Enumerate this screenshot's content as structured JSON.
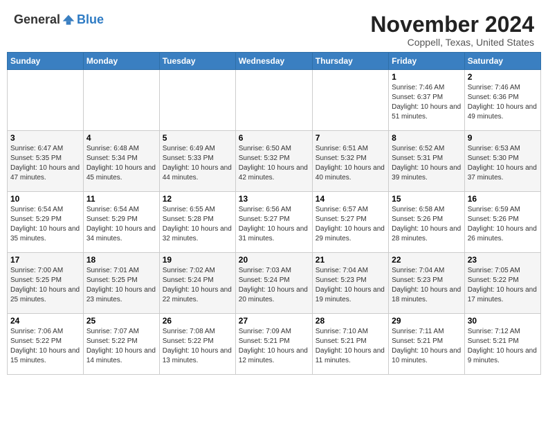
{
  "header": {
    "logo_general": "General",
    "logo_blue": "Blue",
    "month_title": "November 2024",
    "location": "Coppell, Texas, United States"
  },
  "days_of_week": [
    "Sunday",
    "Monday",
    "Tuesday",
    "Wednesday",
    "Thursday",
    "Friday",
    "Saturday"
  ],
  "weeks": [
    [
      {
        "day": "",
        "info": ""
      },
      {
        "day": "",
        "info": ""
      },
      {
        "day": "",
        "info": ""
      },
      {
        "day": "",
        "info": ""
      },
      {
        "day": "",
        "info": ""
      },
      {
        "day": "1",
        "info": "Sunrise: 7:46 AM\nSunset: 6:37 PM\nDaylight: 10 hours\nand 51 minutes."
      },
      {
        "day": "2",
        "info": "Sunrise: 7:46 AM\nSunset: 6:36 PM\nDaylight: 10 hours\nand 49 minutes."
      }
    ],
    [
      {
        "day": "3",
        "info": "Sunrise: 6:47 AM\nSunset: 5:35 PM\nDaylight: 10 hours\nand 47 minutes."
      },
      {
        "day": "4",
        "info": "Sunrise: 6:48 AM\nSunset: 5:34 PM\nDaylight: 10 hours\nand 45 minutes."
      },
      {
        "day": "5",
        "info": "Sunrise: 6:49 AM\nSunset: 5:33 PM\nDaylight: 10 hours\nand 44 minutes."
      },
      {
        "day": "6",
        "info": "Sunrise: 6:50 AM\nSunset: 5:32 PM\nDaylight: 10 hours\nand 42 minutes."
      },
      {
        "day": "7",
        "info": "Sunrise: 6:51 AM\nSunset: 5:32 PM\nDaylight: 10 hours\nand 40 minutes."
      },
      {
        "day": "8",
        "info": "Sunrise: 6:52 AM\nSunset: 5:31 PM\nDaylight: 10 hours\nand 39 minutes."
      },
      {
        "day": "9",
        "info": "Sunrise: 6:53 AM\nSunset: 5:30 PM\nDaylight: 10 hours\nand 37 minutes."
      }
    ],
    [
      {
        "day": "10",
        "info": "Sunrise: 6:54 AM\nSunset: 5:29 PM\nDaylight: 10 hours\nand 35 minutes."
      },
      {
        "day": "11",
        "info": "Sunrise: 6:54 AM\nSunset: 5:29 PM\nDaylight: 10 hours\nand 34 minutes."
      },
      {
        "day": "12",
        "info": "Sunrise: 6:55 AM\nSunset: 5:28 PM\nDaylight: 10 hours\nand 32 minutes."
      },
      {
        "day": "13",
        "info": "Sunrise: 6:56 AM\nSunset: 5:27 PM\nDaylight: 10 hours\nand 31 minutes."
      },
      {
        "day": "14",
        "info": "Sunrise: 6:57 AM\nSunset: 5:27 PM\nDaylight: 10 hours\nand 29 minutes."
      },
      {
        "day": "15",
        "info": "Sunrise: 6:58 AM\nSunset: 5:26 PM\nDaylight: 10 hours\nand 28 minutes."
      },
      {
        "day": "16",
        "info": "Sunrise: 6:59 AM\nSunset: 5:26 PM\nDaylight: 10 hours\nand 26 minutes."
      }
    ],
    [
      {
        "day": "17",
        "info": "Sunrise: 7:00 AM\nSunset: 5:25 PM\nDaylight: 10 hours\nand 25 minutes."
      },
      {
        "day": "18",
        "info": "Sunrise: 7:01 AM\nSunset: 5:25 PM\nDaylight: 10 hours\nand 23 minutes."
      },
      {
        "day": "19",
        "info": "Sunrise: 7:02 AM\nSunset: 5:24 PM\nDaylight: 10 hours\nand 22 minutes."
      },
      {
        "day": "20",
        "info": "Sunrise: 7:03 AM\nSunset: 5:24 PM\nDaylight: 10 hours\nand 20 minutes."
      },
      {
        "day": "21",
        "info": "Sunrise: 7:04 AM\nSunset: 5:23 PM\nDaylight: 10 hours\nand 19 minutes."
      },
      {
        "day": "22",
        "info": "Sunrise: 7:04 AM\nSunset: 5:23 PM\nDaylight: 10 hours\nand 18 minutes."
      },
      {
        "day": "23",
        "info": "Sunrise: 7:05 AM\nSunset: 5:22 PM\nDaylight: 10 hours\nand 17 minutes."
      }
    ],
    [
      {
        "day": "24",
        "info": "Sunrise: 7:06 AM\nSunset: 5:22 PM\nDaylight: 10 hours\nand 15 minutes."
      },
      {
        "day": "25",
        "info": "Sunrise: 7:07 AM\nSunset: 5:22 PM\nDaylight: 10 hours\nand 14 minutes."
      },
      {
        "day": "26",
        "info": "Sunrise: 7:08 AM\nSunset: 5:22 PM\nDaylight: 10 hours\nand 13 minutes."
      },
      {
        "day": "27",
        "info": "Sunrise: 7:09 AM\nSunset: 5:21 PM\nDaylight: 10 hours\nand 12 minutes."
      },
      {
        "day": "28",
        "info": "Sunrise: 7:10 AM\nSunset: 5:21 PM\nDaylight: 10 hours\nand 11 minutes."
      },
      {
        "day": "29",
        "info": "Sunrise: 7:11 AM\nSunset: 5:21 PM\nDaylight: 10 hours\nand 10 minutes."
      },
      {
        "day": "30",
        "info": "Sunrise: 7:12 AM\nSunset: 5:21 PM\nDaylight: 10 hours\nand 9 minutes."
      }
    ]
  ]
}
